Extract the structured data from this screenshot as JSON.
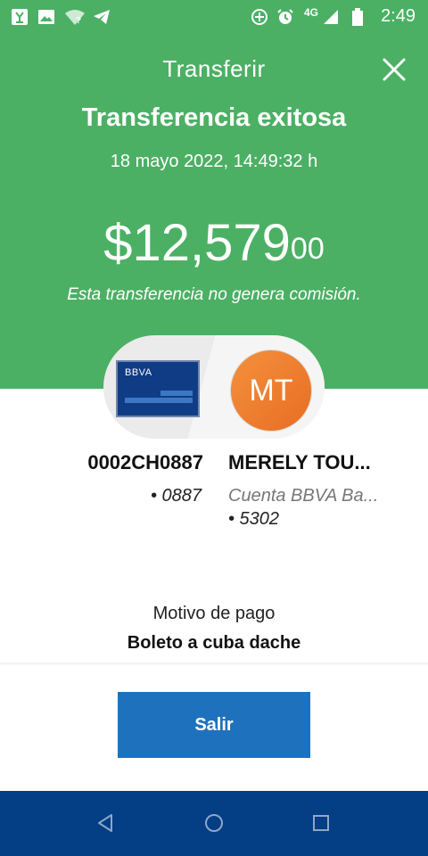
{
  "status_bar": {
    "time": "2:49",
    "network": "4G",
    "icons": [
      "app-icon",
      "image-icon",
      "wifi-question-icon",
      "telegram-icon",
      "add-circle-icon",
      "alarm-icon",
      "signal-icon",
      "battery-icon"
    ]
  },
  "header": {
    "title": "Transferir",
    "close_icon": "close-icon",
    "subtitle": "Transferencia exitosa",
    "datetime": "18 mayo 2022, 14:49:32 h",
    "amount_main": "$12,579",
    "amount_decimal": "00",
    "commission_note": "Esta transferencia no genera comisión."
  },
  "transfer": {
    "card_brand": "BBVA",
    "avatar_initials": "MT",
    "from_account": "0002CH0887",
    "from_last4": "• 0887",
    "to_name": "MERELY TOU...",
    "to_bank": "Cuenta BBVA Ba...",
    "to_last4": "• 5302"
  },
  "payment_reason": {
    "label": "Motivo de pago",
    "value": "Boleto a cuba dache"
  },
  "actions": {
    "exit_label": "Salir"
  },
  "nav_bar": {
    "icons": [
      "back-icon",
      "home-icon",
      "recents-icon"
    ]
  },
  "colors": {
    "header_green": "#4bb064",
    "button_blue": "#1e72bd",
    "nav_blue": "#043e84",
    "avatar_orange": "#ef7f2f",
    "card_blue": "#0f3c84"
  }
}
